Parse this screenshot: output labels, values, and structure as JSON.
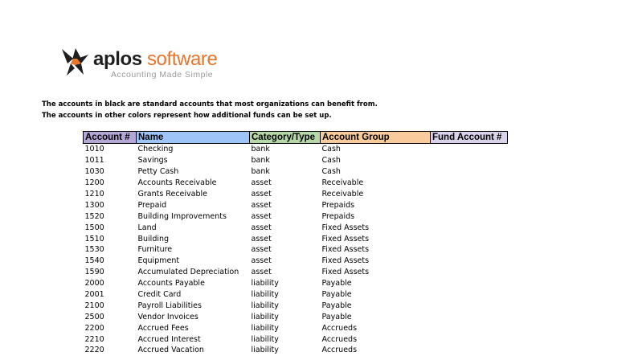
{
  "logo": {
    "word_part1": "aplos",
    "word_part2": " software",
    "tagline": "Accounting Made Simple",
    "colors": {
      "dark": "#1f1f1f",
      "accent": "#e9742c",
      "tagline": "#9a9a9a"
    }
  },
  "intro": {
    "line1": "The accounts in black are standard accounts that most organizations can benefit from.",
    "line2": "The accounts in other colors represent how additional funds can be set up."
  },
  "table": {
    "headers": [
      "Account #",
      "Name",
      "Category/Type",
      "Account Group",
      "Fund Account #"
    ],
    "header_colors": [
      "#b4a7d6",
      "#9fc5f8",
      "#b6d7a8",
      "#f9cb9c",
      "#d9d2e9"
    ],
    "rows": [
      [
        "1010",
        "Checking",
        "bank",
        "Cash",
        ""
      ],
      [
        "1011",
        "Savings",
        "bank",
        "Cash",
        ""
      ],
      [
        "1030",
        "Petty Cash",
        "bank",
        "Cash",
        ""
      ],
      [
        "1200",
        "Accounts Receivable",
        "asset",
        "Receivable",
        ""
      ],
      [
        "1210",
        "Grants Receivable",
        "asset",
        "Receivable",
        ""
      ],
      [
        "1300",
        "Prepaid",
        "asset",
        "Prepaids",
        ""
      ],
      [
        "1520",
        "Building Improvements",
        "asset",
        "Prepaids",
        ""
      ],
      [
        "1500",
        "Land",
        "asset",
        "Fixed Assets",
        ""
      ],
      [
        "1510",
        "Building",
        "asset",
        "Fixed Assets",
        ""
      ],
      [
        "1530",
        "Furniture",
        "asset",
        "Fixed Assets",
        ""
      ],
      [
        "1540",
        "Equipment",
        "asset",
        "Fixed Assets",
        ""
      ],
      [
        "1590",
        "Accumulated Depreciation",
        "asset",
        "Fixed Assets",
        ""
      ],
      [
        "2000",
        "Accounts Payable",
        "liability",
        "Payable",
        ""
      ],
      [
        "2001",
        "Credit Card",
        "liability",
        "Payable",
        ""
      ],
      [
        "2100",
        "Payroll Liabilities",
        "liability",
        "Payable",
        ""
      ],
      [
        "2500",
        "Vendor Invoices",
        "liability",
        "Payable",
        ""
      ],
      [
        "2200",
        "Accrued Fees",
        "liability",
        "Accrueds",
        ""
      ],
      [
        "2210",
        "Accrued Interest",
        "liability",
        "Accrueds",
        ""
      ],
      [
        "2220",
        "Accrued Vacation",
        "liability",
        "Accrueds",
        ""
      ]
    ]
  }
}
